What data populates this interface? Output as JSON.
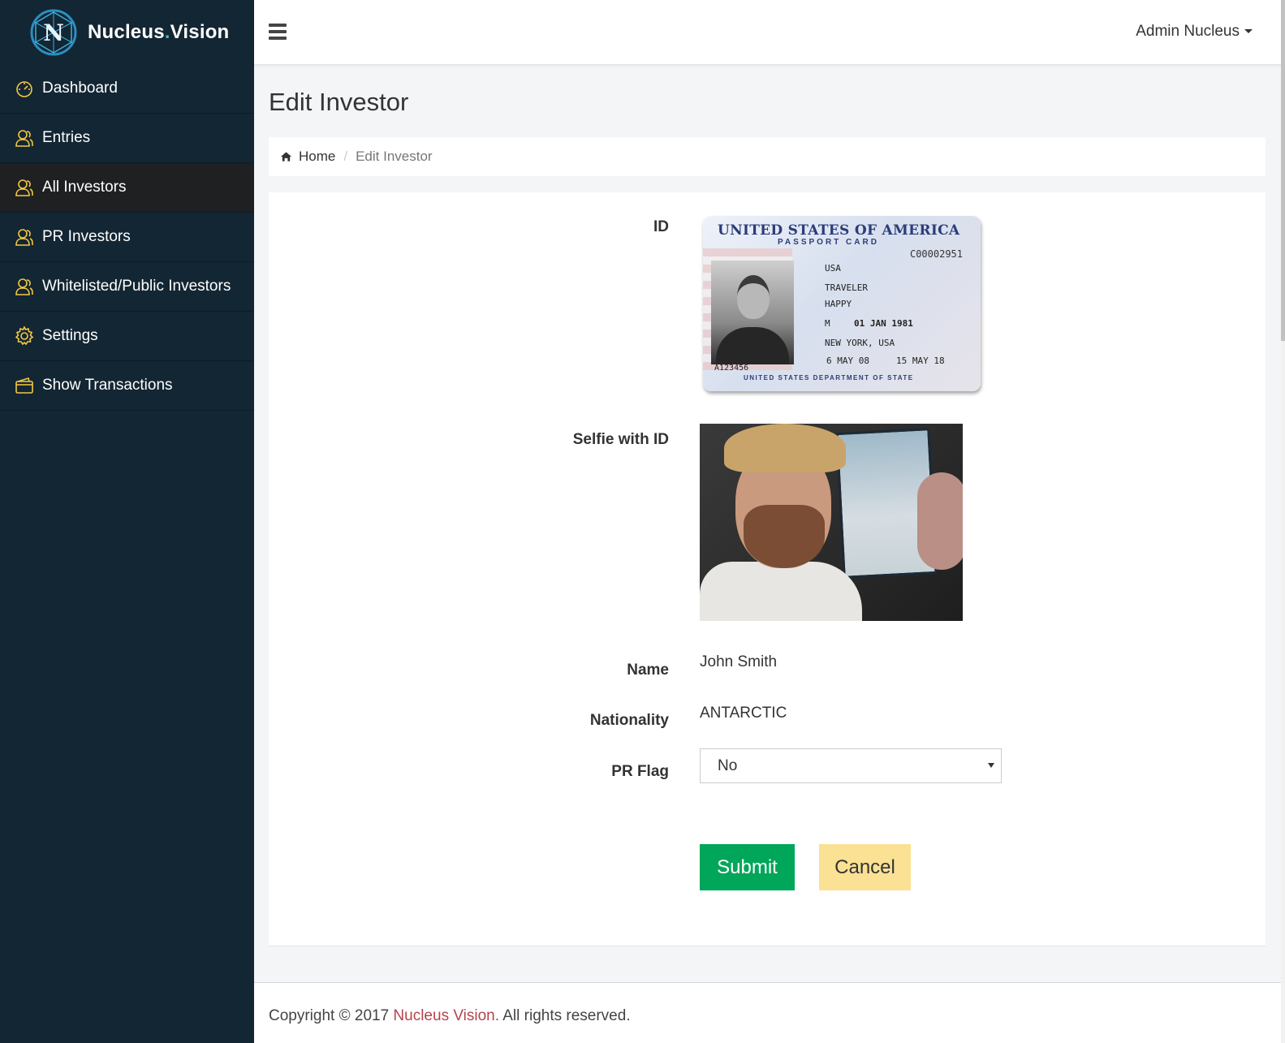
{
  "brand": {
    "name_part1": "Nucleus",
    "name_dot": ".",
    "name_part2": "Vision"
  },
  "sidebar": {
    "items": [
      {
        "label": "Dashboard",
        "icon": "dashboard-icon"
      },
      {
        "label": "Entries",
        "icon": "users-icon"
      },
      {
        "label": "All Investors",
        "icon": "users-icon",
        "active": true
      },
      {
        "label": "PR Investors",
        "icon": "users-icon"
      },
      {
        "label": "Whitelisted/Public Investors",
        "icon": "users-icon"
      },
      {
        "label": "Settings",
        "icon": "gear-icon"
      },
      {
        "label": "Show Transactions",
        "icon": "wallet-icon"
      }
    ]
  },
  "topbar": {
    "user": "Admin Nucleus"
  },
  "page": {
    "title": "Edit Investor"
  },
  "breadcrumb": {
    "home": "Home",
    "current": "Edit Investor"
  },
  "form": {
    "id_label": "ID",
    "selfie_label": "Selfie with ID",
    "name_label": "Name",
    "name_value": "John Smith",
    "nationality_label": "Nationality",
    "nationality_value": "ANTARCTIC",
    "pr_flag_label": "PR Flag",
    "pr_flag_value": "No",
    "submit": "Submit",
    "cancel": "Cancel"
  },
  "id_card": {
    "title": "UNITED STATES OF AMERICA",
    "subtitle": "PASSPORT CARD",
    "card_no": "C00002951",
    "nationality": "USA",
    "surname": "TRAVELER",
    "given_names": "HAPPY",
    "sex": "M",
    "dob": "01 JAN 1981",
    "pob": "NEW YORK, USA",
    "issued": "6 MAY 08",
    "expires": "15 MAY 18",
    "id_no": "A123456",
    "dept": "UNITED STATES DEPARTMENT OF STATE"
  },
  "footer": {
    "prefix": "Copyright © 2017 ",
    "link": "Nucleus Vision.",
    "suffix": " All rights reserved."
  },
  "colors": {
    "sidebar": "#132633",
    "accent_icon": "#f5c842",
    "submit": "#00a65a",
    "cancel": "#fbe194",
    "footer_link": "#b3454c"
  }
}
